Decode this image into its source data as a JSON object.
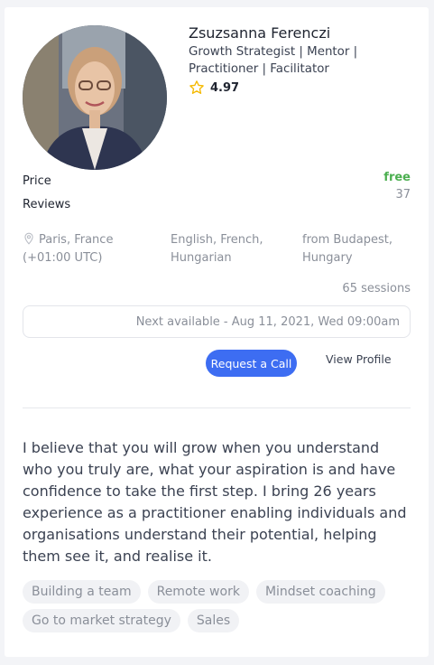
{
  "profile": {
    "name": "Zsuzsanna Ferenczi",
    "title": "Growth Strategist | Mentor | Practitioner | Facilitator",
    "rating": "4.97",
    "price_label": "Price",
    "price_value": "free",
    "reviews_label": "Reviews",
    "reviews_value": "37",
    "location": "Paris, France (+01:00 UTC)",
    "languages": "English, French, Hungarian",
    "origin": "from Budapest, Hungary",
    "sessions": "65 sessions",
    "next_available": "Next available - Aug 11, 2021, Wed 09:00am",
    "request_label": "Request a Call",
    "view_label": "View Profile",
    "bio": "I believe that you will grow when you understand who you truly are, what your aspiration is and have confidence to take the first step. I bring 26 years experience as a practitioner enabling individuals and organisations understand their potential, helping them see it, and realise it.",
    "tags": [
      "Building a team",
      "Remote work",
      "Mindset coaching",
      "Go to market strategy",
      "Sales"
    ]
  },
  "colors": {
    "accent": "#3d6df2",
    "free": "#4caf50",
    "star": "#f5b900"
  },
  "icons": {
    "rating": "star-icon",
    "location": "location-pin-icon"
  }
}
